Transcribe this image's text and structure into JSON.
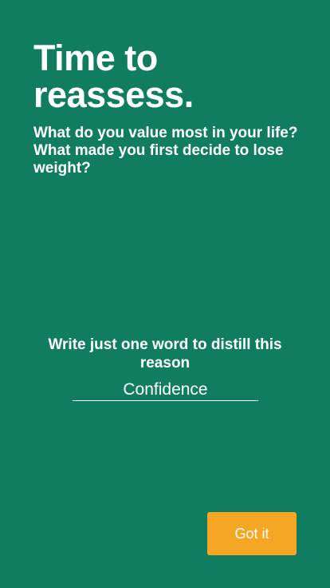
{
  "header": {
    "title": "Time to reassess.",
    "subtitle": "What do you value most in your life? What made you first decide to lose weight?"
  },
  "prompt": {
    "text": "Write just one word to distill this reason"
  },
  "word_field": {
    "value": "Confidence"
  },
  "actions": {
    "got_it_label": "Got it"
  },
  "colors": {
    "background": "#117d60",
    "button": "#f5a623",
    "text": "#ffffff"
  }
}
